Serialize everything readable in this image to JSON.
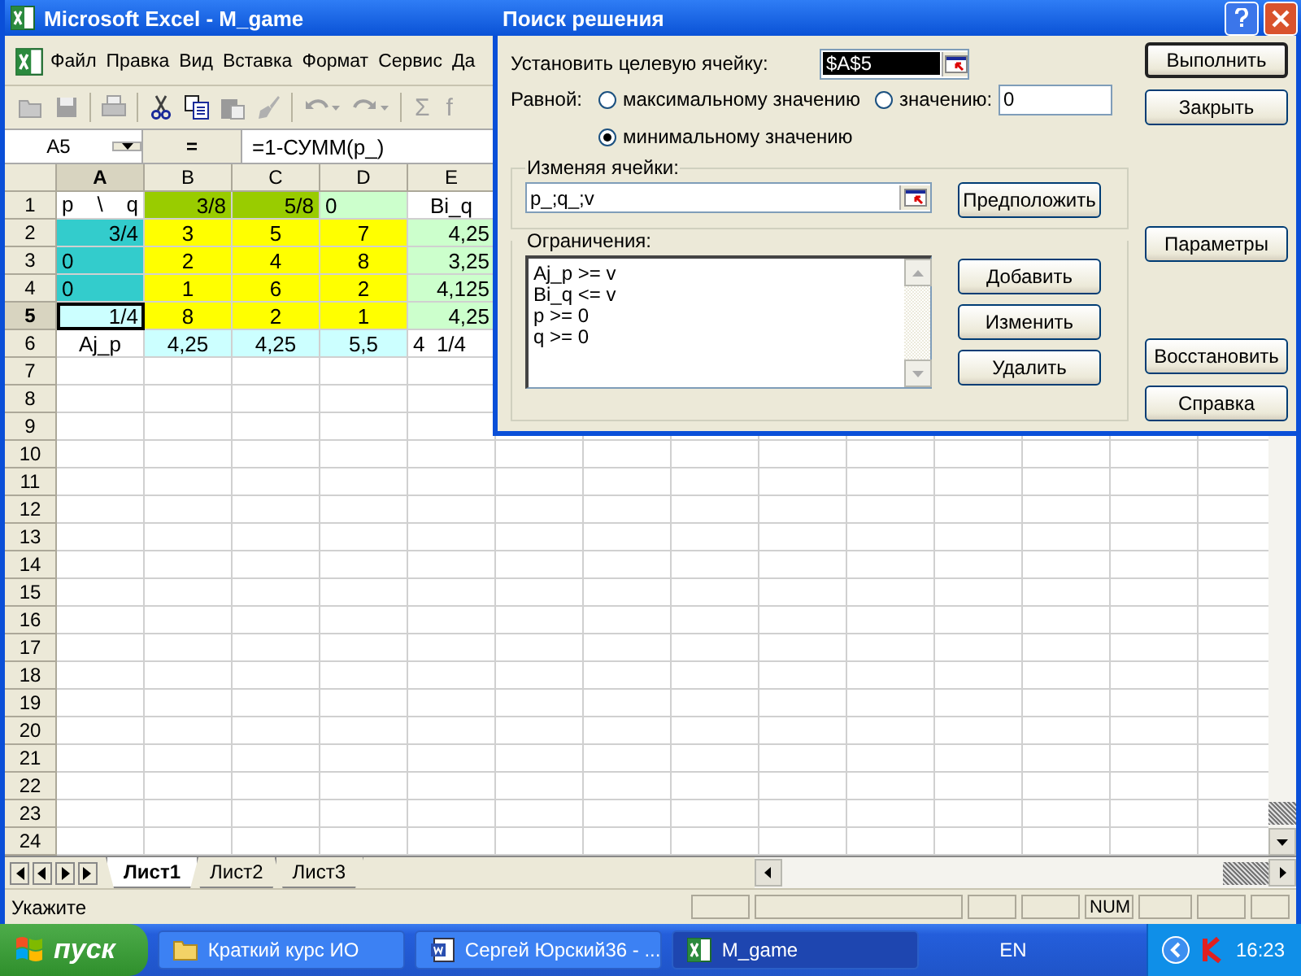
{
  "excel": {
    "title": "Microsoft Excel - M_game",
    "menu": [
      "Файл",
      "Правка",
      "Вид",
      "Вставка",
      "Формат",
      "Сервис",
      "Да"
    ],
    "toolbar": [
      {
        "kind": "open",
        "disabled": true
      },
      {
        "kind": "save",
        "disabled": true
      },
      {
        "kind": "print",
        "disabled": true
      },
      {
        "kind": "cut",
        "disabled": false
      },
      {
        "kind": "copy",
        "disabled": false
      },
      {
        "kind": "paste",
        "disabled": true
      },
      {
        "kind": "brush",
        "disabled": true
      },
      {
        "kind": "undo",
        "disabled": true
      },
      {
        "kind": "redo",
        "disabled": true
      },
      {
        "kind": "glyph",
        "text": "Σ",
        "disabled": true
      },
      {
        "kind": "glyph",
        "text": "f",
        "disabled": true
      }
    ],
    "name_box": "A5",
    "formula_sign": "=",
    "formula": "=1-СУММ(p_)",
    "columns": [
      {
        "label": "A",
        "selected": true
      },
      {
        "label": "B",
        "selected": false
      },
      {
        "label": "C",
        "selected": false
      },
      {
        "label": "D",
        "selected": false
      },
      {
        "label": "E",
        "selected": false
      }
    ],
    "rows": [
      {
        "header": "1",
        "selected": false,
        "cells": [
          {
            "text": "p \\ q",
            "kind": "spread"
          },
          {
            "text": "3/8",
            "kind": "number",
            "color": "#99cc00"
          },
          {
            "text": "5/8",
            "kind": "number",
            "color": "#99cc00"
          },
          {
            "text": "0",
            "kind": "text",
            "color": "#ccffcc"
          },
          {
            "text": "Bi_q",
            "kind": "label"
          }
        ]
      },
      {
        "header": "2",
        "selected": false,
        "cells": [
          {
            "text": "3/4",
            "kind": "number",
            "color": "#33cccc"
          },
          {
            "text": "3",
            "kind": "label",
            "color": "#ffff00"
          },
          {
            "text": "5",
            "kind": "label",
            "color": "#ffff00"
          },
          {
            "text": "7",
            "kind": "label",
            "color": "#ffff00"
          },
          {
            "text": "4,25",
            "kind": "number",
            "color": "#ccffcc"
          }
        ]
      },
      {
        "header": "3",
        "selected": false,
        "cells": [
          {
            "text": "0",
            "kind": "text",
            "color": "#33cccc"
          },
          {
            "text": "2",
            "kind": "label",
            "color": "#ffff00"
          },
          {
            "text": "4",
            "kind": "label",
            "color": "#ffff00"
          },
          {
            "text": "8",
            "kind": "label",
            "color": "#ffff00"
          },
          {
            "text": "3,25",
            "kind": "number",
            "color": "#ccffcc"
          }
        ]
      },
      {
        "header": "4",
        "selected": false,
        "cells": [
          {
            "text": "0",
            "kind": "text",
            "color": "#33cccc"
          },
          {
            "text": "1",
            "kind": "label",
            "color": "#ffff00"
          },
          {
            "text": "6",
            "kind": "label",
            "color": "#ffff00"
          },
          {
            "text": "2",
            "kind": "label",
            "color": "#ffff00"
          },
          {
            "text": "4,125",
            "kind": "number",
            "color": "#ccffcc"
          }
        ]
      },
      {
        "header": "5",
        "selected": true,
        "cells": [
          {
            "text": "1/4",
            "kind": "number",
            "color": "#ccffff"
          },
          {
            "text": "8",
            "kind": "label",
            "color": "#ffff00"
          },
          {
            "text": "2",
            "kind": "label",
            "color": "#ffff00"
          },
          {
            "text": "1",
            "kind": "label",
            "color": "#ffff00"
          },
          {
            "text": "4,25",
            "kind": "number",
            "color": "#ccffcc"
          }
        ]
      },
      {
        "header": "6",
        "selected": false,
        "cells": [
          {
            "text": "Aj_p",
            "kind": "label"
          },
          {
            "text": "4,25",
            "kind": "label",
            "color": "#ccffff"
          },
          {
            "text": "4,25",
            "kind": "label",
            "color": "#ccffff"
          },
          {
            "text": "5,5",
            "kind": "label",
            "color": "#ccffff"
          },
          {
            "text": "4  1/4",
            "kind": "text"
          }
        ]
      },
      {
        "header": "7",
        "selected": false
      },
      {
        "header": "8",
        "selected": false
      },
      {
        "header": "9",
        "selected": false
      },
      {
        "header": "10",
        "selected": false
      },
      {
        "header": "11",
        "selected": false
      },
      {
        "header": "12",
        "selected": false
      },
      {
        "header": "13",
        "selected": false
      },
      {
        "header": "14",
        "selected": false
      },
      {
        "header": "15",
        "selected": false
      },
      {
        "header": "16",
        "selected": false
      },
      {
        "header": "17",
        "selected": false
      },
      {
        "header": "18",
        "selected": false
      },
      {
        "header": "19",
        "selected": false
      },
      {
        "header": "20",
        "selected": false
      },
      {
        "header": "21",
        "selected": false
      },
      {
        "header": "22",
        "selected": false
      },
      {
        "header": "23",
        "selected": false
      },
      {
        "header": "24",
        "selected": false
      }
    ],
    "sheets": [
      {
        "label": "Лист1",
        "selected": true
      },
      {
        "label": "Лист2",
        "selected": false
      },
      {
        "label": "Лист3",
        "selected": false
      }
    ],
    "status_bar": {
      "message": "Укажите",
      "num_lock": "NUM"
    }
  },
  "solver": {
    "title": "Поиск решения",
    "target_label": "Установить целевую ячейку:",
    "target_value": "$A$5",
    "equal_label": "Равной:",
    "options": [
      {
        "label": "максимальному значению",
        "selected": false
      },
      {
        "label": "значению:",
        "selected": false
      },
      {
        "label": "минимальному значению",
        "selected": true
      }
    ],
    "value_field": "0",
    "changing_label": "Изменяя ячейки:",
    "changing_value": "p_;q_;v",
    "guess_button": "Предположить",
    "constraints_label": "Ограничения:",
    "constraints": [
      "Aj_p >= v",
      "Bi_q <= v",
      "p >= 0",
      "q >= 0"
    ],
    "constraint_buttons": [
      "Добавить",
      "Изменить",
      "Удалить"
    ],
    "side_buttons": [
      {
        "label": "Выполнить",
        "default": true
      },
      {
        "label": "Закрыть",
        "default": false
      },
      {
        "label": "Параметры",
        "default": false
      },
      {
        "label": "Восстановить",
        "default": false
      },
      {
        "label": "Справка",
        "default": false
      }
    ]
  },
  "taskbar": {
    "start": "пуск",
    "tasks": [
      {
        "label": "Краткий курс ИО",
        "kind": "folder",
        "selected": false
      },
      {
        "label": "Сергей Юрский36 - ...",
        "kind": "word",
        "selected": false
      },
      {
        "label": "M_game",
        "kind": "excel",
        "selected": true
      }
    ],
    "language": "EN",
    "clock": "16:23"
  }
}
